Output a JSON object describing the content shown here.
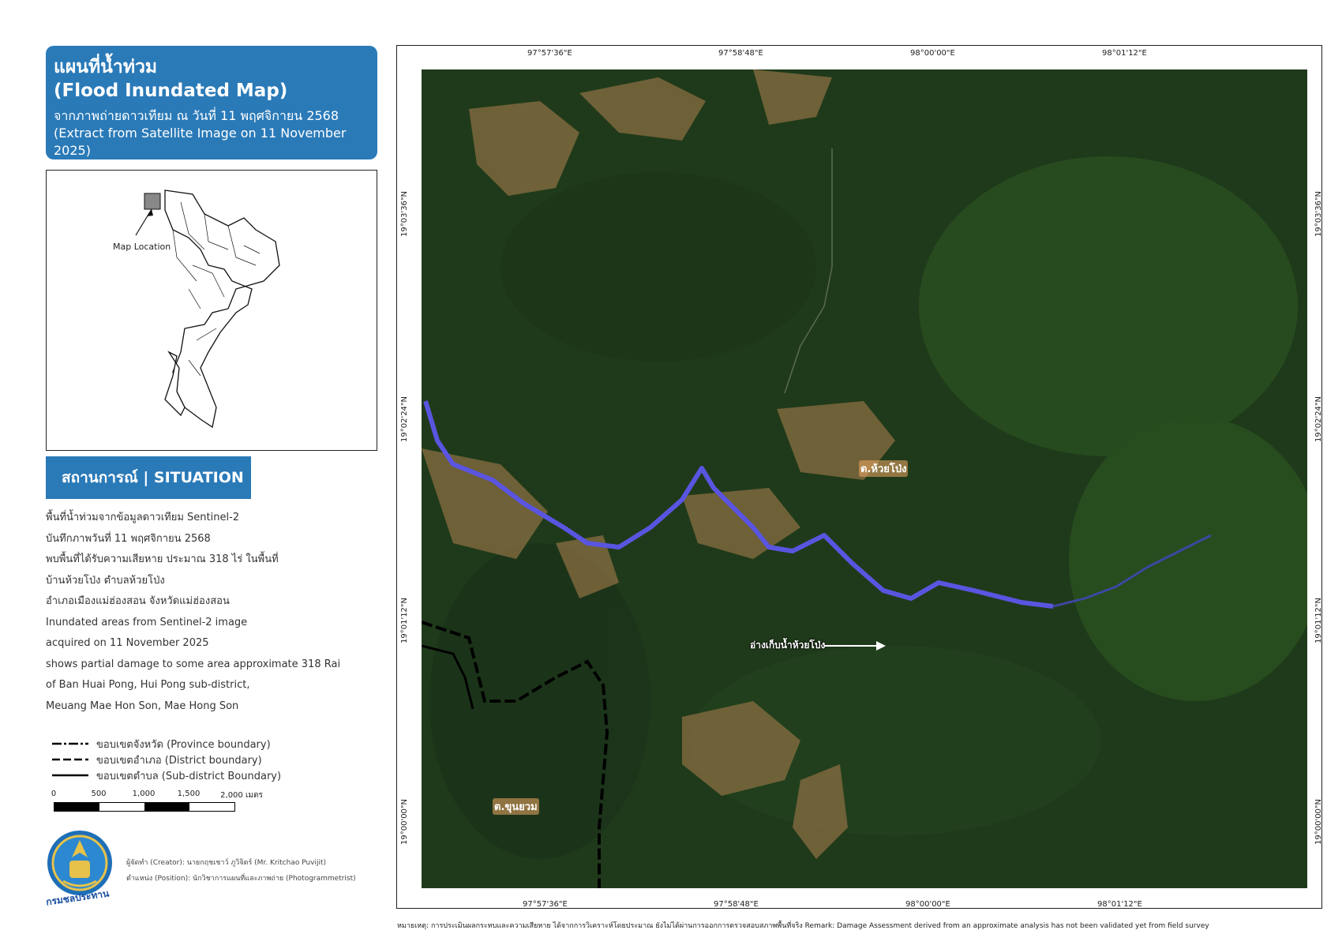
{
  "title": {
    "th": "แผนที่น้ำท่วม",
    "en": "(Flood Inundated Map)",
    "sub_th": "จากภาพถ่ายดาวเทียม ณ วันที่ 11 พฤศจิกายน 2568",
    "sub_en": "(Extract from Satellite Image on 11 November 2025)"
  },
  "inset": {
    "label": "Map Location"
  },
  "situation": {
    "heading": "สถานการณ์ | SITUATION",
    "lines": [
      "พื้นที่น้ำท่วมจากข้อมูลดาวเทียม Sentinel-2",
      "บันทึกภาพวันที่ 11 พฤศจิกายน 2568",
      "พบพื้นที่ได้รับความเสียหาย ประมาณ 318 ไร่ ในพื้นที่",
      "บ้านห้วยโป่ง ตำบลห้วยโป่ง",
      "อำเภอเมืองแม่ฮ่องสอน จังหวัดแม่ฮ่องสอน",
      "Inundated areas from Sentinel-2 image",
      "acquired on 11 November 2025",
      "shows partial damage to some area approximate 318 Rai",
      "of Ban Huai Pong, Hui Pong sub-district,",
      "Meuang Mae Hon Son, Mae Hong Son"
    ]
  },
  "legend": [
    {
      "label": "ขอบเขตจังหวัด (Province boundary)",
      "style": "dashdot"
    },
    {
      "label": "ขอบเขตอำเภอ (District boundary)",
      "style": "dashed"
    },
    {
      "label": "ขอบเขตตำบล (Sub-district Boundary)",
      "style": "solid"
    }
  ],
  "scale": {
    "ticks": [
      "0",
      "500",
      "1,000",
      "1,500",
      "2,000 เมตร"
    ]
  },
  "credits": {
    "logo_text": "กรมชลประทาน",
    "creator": "ผู้จัดทำ (Creator): นายกฤชเชาว์ ภูวิจิตร์ (Mr. Kritchao Puvijit)",
    "position": "ตำแหน่ง (Position): นักวิชาการแผนที่และภาพถ่าย (Photogrammetrist)"
  },
  "map": {
    "lon_labels": [
      "97°57'36\"E",
      "97°58'48\"E",
      "98°00'00\"E",
      "98°01'12\"E"
    ],
    "lat_labels": [
      "19°03'36\"N",
      "19°02'24\"N",
      "19°01'12\"N",
      "19°00'00\"N"
    ],
    "places": {
      "huai_pong": "ต.ห้วยโป่ง",
      "khun_yuam": "ต.ขุนยวม",
      "reservoir": "อ่างเก็บน้ำห้วยโป่ง"
    },
    "colors": {
      "forest": "#1f3a1a",
      "flood": "#5a55e0",
      "farmland": "#a08050"
    }
  },
  "remark": "หมายเหตุ: การประเมินผลกระทบและความเสียหาย ได้จากการวิเคราะห์โดยประมาณ ยังไม่ได้ผ่านการออกการตรวจสอบสภาพพื้นที่จริง Remark: Damage Assessment derived from an approximate analysis has not been validated yet from field survey"
}
